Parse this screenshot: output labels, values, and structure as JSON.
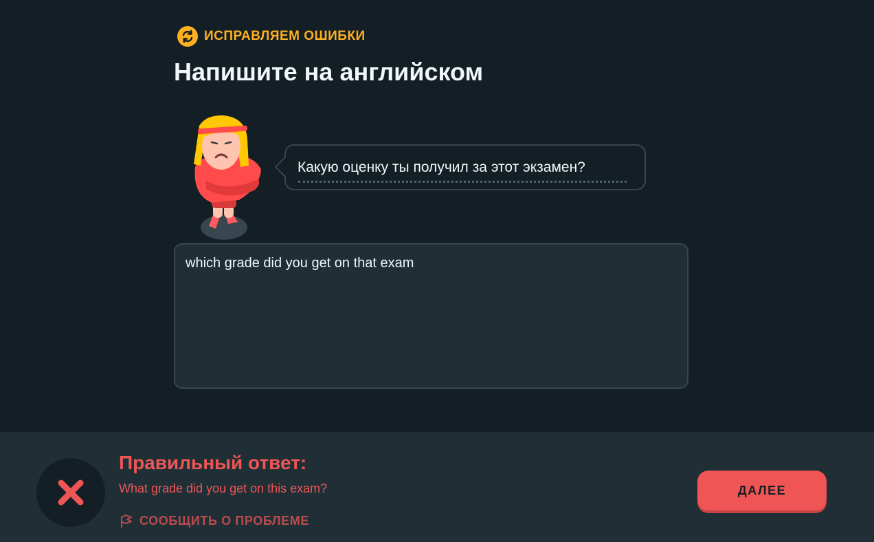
{
  "challenge": {
    "badge_label": "ИСПРАВЛЯЕМ ОШИБКИ",
    "badge_icon": "refresh-arrows-icon",
    "title": "Напишите на английском",
    "prompt": "Какую оценку ты получил за этот экзамен?",
    "answer_value": "which grade did you get on that exam"
  },
  "feedback": {
    "status": "incorrect",
    "title": "Правильный ответ:",
    "correct_answer": "What grade did you get on this exam?",
    "report_label": "СООБЩИТЬ О ПРОБЛЕМЕ",
    "report_icon": "flag-icon",
    "result_icon": "x-icon",
    "continue_label": "ДАЛЕЕ"
  },
  "colors": {
    "background": "#131f24",
    "panel": "#202f36",
    "accent_orange": "#ffb020",
    "error_red": "#ee5555",
    "text": "#f1f7fb"
  }
}
